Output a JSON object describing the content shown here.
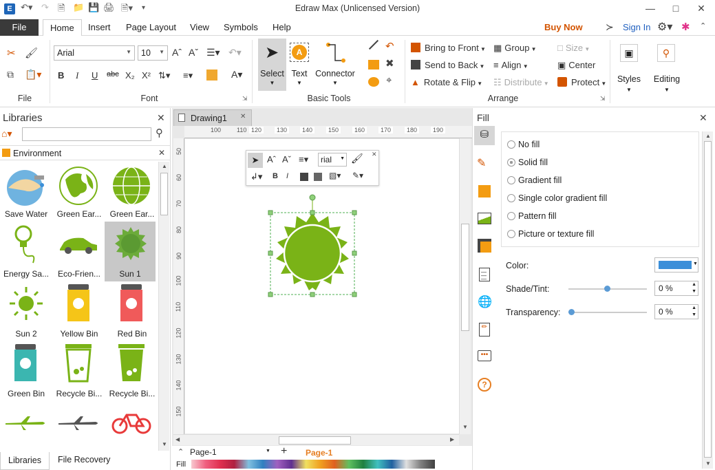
{
  "app": {
    "title": "Edraw Max (Unlicensed Version)"
  },
  "menu": {
    "file": "File",
    "tabs": [
      "Home",
      "Insert",
      "Page Layout",
      "View",
      "Symbols",
      "Help"
    ],
    "buy_now": "Buy Now",
    "sign_in": "Sign In"
  },
  "ribbon": {
    "groups": {
      "file": "File",
      "font": "Font",
      "basic_tools": "Basic Tools",
      "arrange": "Arrange"
    },
    "font": {
      "family": "Arial",
      "size": "10"
    },
    "tools": {
      "select": "Select",
      "text": "Text",
      "connector": "Connector"
    },
    "arrange": {
      "bring_to_front": "Bring to Front",
      "send_to_back": "Send to Back",
      "rotate_flip": "Rotate & Flip",
      "group": "Group",
      "align": "Align",
      "distribute": "Distribute",
      "size": "Size",
      "center": "Center",
      "protect": "Protect"
    },
    "styles": "Styles",
    "editing": "Editing"
  },
  "libraries": {
    "title": "Libraries",
    "search_placeholder": "",
    "category": "Environment",
    "items": [
      {
        "label": "Save Water"
      },
      {
        "label": "Green Ear..."
      },
      {
        "label": "Green Ear..."
      },
      {
        "label": "Energy Sa..."
      },
      {
        "label": "Eco-Frien..."
      },
      {
        "label": "Sun 1"
      },
      {
        "label": "Sun 2"
      },
      {
        "label": "Yellow Bin"
      },
      {
        "label": "Red Bin"
      },
      {
        "label": "Green Bin"
      },
      {
        "label": "Recycle Bi..."
      },
      {
        "label": "Recycle Bi..."
      },
      {
        "label": ""
      },
      {
        "label": ""
      },
      {
        "label": ""
      }
    ],
    "bottom_tabs": [
      "Libraries",
      "File Recovery"
    ]
  },
  "document": {
    "tab": "Drawing1",
    "ruler_h": [
      "100",
      "110",
      "120",
      "130",
      "140",
      "150",
      "160",
      "170",
      "180",
      "190"
    ],
    "ruler_v": [
      "50",
      "60",
      "70",
      "80",
      "90",
      "100",
      "110",
      "120",
      "130",
      "140",
      "150"
    ],
    "mini_toolbar": {
      "font": "rial"
    }
  },
  "pages": {
    "current": "Page-1",
    "tab": "Page-1",
    "fill_label": "Fill"
  },
  "fill_panel": {
    "title": "Fill",
    "options": [
      {
        "label": "No fill",
        "selected": false
      },
      {
        "label": "Solid fill",
        "selected": true
      },
      {
        "label": "Gradient fill",
        "selected": false
      },
      {
        "label": "Single color gradient fill",
        "selected": false
      },
      {
        "label": "Pattern fill",
        "selected": false
      },
      {
        "label": "Picture or texture fill",
        "selected": false
      }
    ],
    "color_label": "Color:",
    "color_value": "#3b8fd9",
    "shade_label": "Shade/Tint:",
    "shade_value": "0 %",
    "transparency_label": "Transparency:",
    "transparency_value": "0 %"
  },
  "colors": {
    "accent": "#d35400",
    "file_bg": "#3a3a3a",
    "sun": "#7ab317",
    "orange": "#f39c12"
  }
}
